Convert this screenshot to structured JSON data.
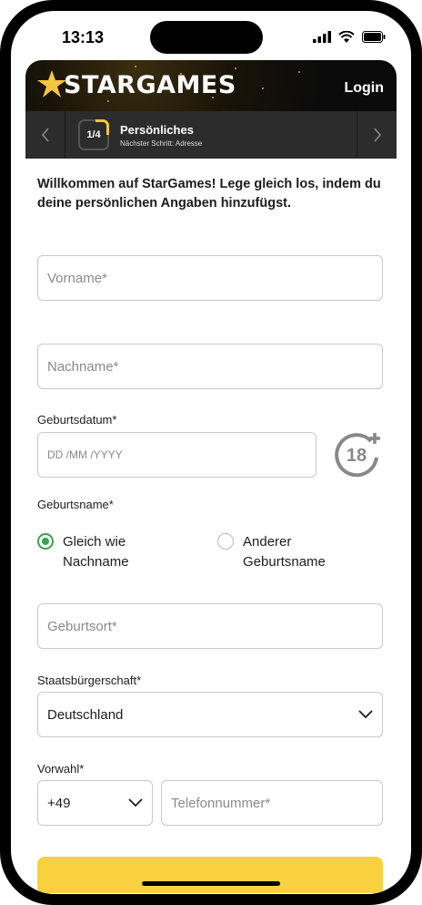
{
  "status": {
    "time": "13:13"
  },
  "header": {
    "brand": "STARGAMES",
    "login_label": "Login"
  },
  "stepper": {
    "counter": "1/4",
    "title": "Persönliches",
    "next_step": "Nächster Schritt: Adresse"
  },
  "intro": "Willkommen auf StarGames! Lege gleich los, indem du deine persönlichen Angaben hinzufügst.",
  "form": {
    "firstname": {
      "placeholder": "Vorname*"
    },
    "lastname": {
      "placeholder": "Nachname*"
    },
    "birthdate": {
      "label": "Geburtsdatum*",
      "placeholder": "DD /MM /YYYY",
      "age_badge": "18"
    },
    "birthname": {
      "label": "Geburtsname*",
      "options": [
        {
          "label": "Gleich wie Nachname",
          "selected": true
        },
        {
          "label": "Anderer Geburtsname",
          "selected": false
        }
      ]
    },
    "birthplace": {
      "placeholder": "Geburtsort*"
    },
    "citizenship": {
      "label": "Staatsbürgerschaft*",
      "value": "Deutschland"
    },
    "prefix": {
      "label": "Vorwahl*",
      "value": "+49"
    },
    "phone": {
      "placeholder": "Telefonnummer*"
    }
  },
  "colors": {
    "accent": "#f7d23e",
    "radio_selected": "#3aa04a",
    "header_bg": "#2c2c2c"
  }
}
